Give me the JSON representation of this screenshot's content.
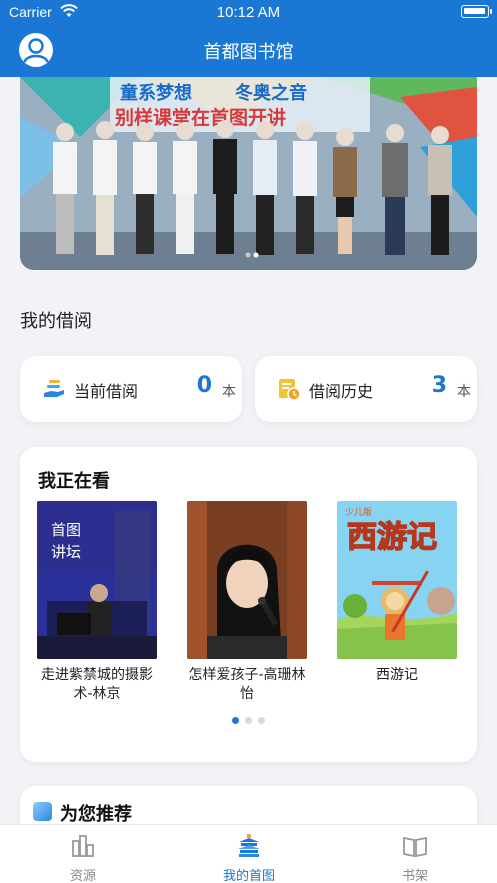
{
  "status_bar": {
    "carrier": "Carrier",
    "time": "10:12 AM"
  },
  "nav": {
    "title": "首都图书馆"
  },
  "banner": {
    "title_line1_left": "童系梦想",
    "title_line1_right": "冬奥之音",
    "title_line2": "别样课堂在首图开讲",
    "page_dots": 2,
    "active_dot": 1
  },
  "my_borrow": {
    "title": "我的借阅",
    "current": {
      "label": "当前借阅",
      "count": "0",
      "unit": "本"
    },
    "history": {
      "label": "借阅历史",
      "count": "3",
      "unit": "本"
    }
  },
  "reading": {
    "title": "我正在看",
    "books": [
      {
        "name": "走进紫禁城的摄影术-林京",
        "cover_text": "首图讲坛"
      },
      {
        "name": "怎样爱孩子-高珊林怡",
        "cover_text": ""
      },
      {
        "name": "西游记",
        "cover_text": "西游记",
        "cover_badge": "少儿版"
      }
    ],
    "page_dots": 3,
    "active_dot": 0
  },
  "recommend": {
    "title": "为您推荐"
  },
  "tabbar": {
    "items": [
      {
        "label": "资源",
        "icon": "chart-icon"
      },
      {
        "label": "我的首图",
        "icon": "temple-icon"
      },
      {
        "label": "书架",
        "icon": "book-icon"
      }
    ],
    "active": 1
  },
  "colors": {
    "primary": "#1a78d4",
    "background": "#f2f3f6"
  }
}
